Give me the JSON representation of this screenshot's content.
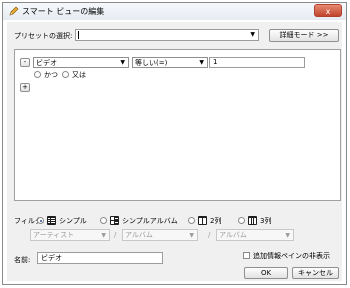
{
  "window": {
    "title": "スマート ビューの編集",
    "close": "x"
  },
  "preset": {
    "label": "プリセットの選択:",
    "value": "",
    "arrow": "▼",
    "detail_button": "詳細モード >>"
  },
  "rule": {
    "minus": "-",
    "field": "ビデオ",
    "operator": "等しい(=)",
    "value": "1",
    "arrow": "▼",
    "and_label": "かつ",
    "or_label": "又は",
    "plus": "+"
  },
  "filter": {
    "label": "フィルタ:",
    "options": [
      "シンプル",
      "シンプルアルバム",
      "2列",
      "3列"
    ],
    "selected": "シンプル",
    "dropdowns": [
      "アーティスト",
      "アルバム",
      "アルバム"
    ],
    "separator": "/",
    "arrow": "▼"
  },
  "name": {
    "label": "名前:",
    "value": "ビデオ"
  },
  "hide_info_pane": {
    "label": "追加情報ペインの非表示",
    "checked": false
  },
  "buttons": {
    "ok": "OK",
    "cancel": "キャンセル"
  }
}
